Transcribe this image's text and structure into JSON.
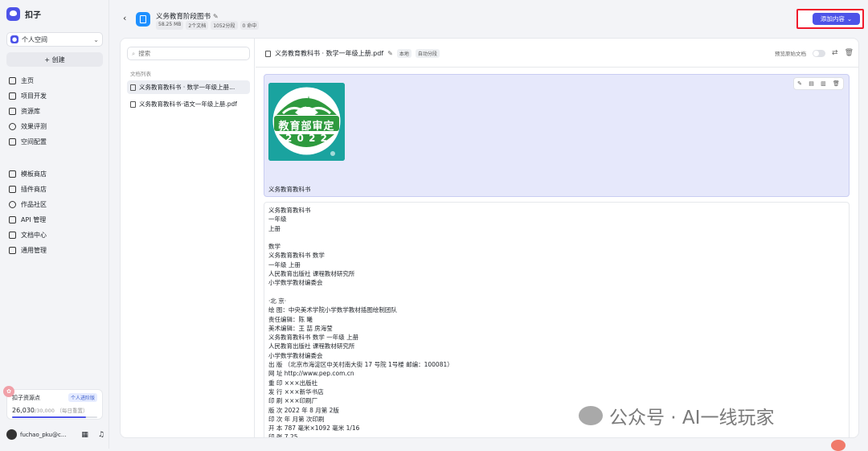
{
  "app": {
    "title": "扣子"
  },
  "sidebar": {
    "space_label": "个人空间",
    "create_label": "+ 创建",
    "nav1": [
      {
        "label": "主页",
        "icon": "home-icon"
      },
      {
        "label": "项目开发",
        "icon": "project-icon"
      },
      {
        "label": "资源库",
        "icon": "library-icon"
      },
      {
        "label": "效果评测",
        "icon": "evaluation-icon"
      },
      {
        "label": "空间配置",
        "icon": "settings-icon"
      }
    ],
    "nav2": [
      {
        "label": "模板商店",
        "icon": "template-icon"
      },
      {
        "label": "插件商店",
        "icon": "plugin-icon"
      },
      {
        "label": "作品社区",
        "icon": "community-icon"
      },
      {
        "label": "API 管理",
        "icon": "api-icon"
      },
      {
        "label": "文档中心",
        "icon": "docs-icon"
      },
      {
        "label": "通用管理",
        "icon": "admin-icon"
      }
    ],
    "resource": {
      "title": "扣子资源点",
      "badge": "个人进阶版",
      "used": "26,030",
      "total": "/30,000",
      "note": "（每日重置）",
      "fill": 0.8677
    },
    "user": {
      "name": "fuchao_pku@c..."
    }
  },
  "header": {
    "kb_title": "义务教育阶段图书",
    "tags": [
      "58.25 MB",
      "2个文档",
      "1052分段",
      "0 命中"
    ],
    "add_button": "添加内容"
  },
  "left_pane": {
    "search_placeholder": "搜索",
    "list_title": "文档列表",
    "docs": [
      "义务教育教科书 · 数学一年级上册...",
      "义务教育教科书·语文一年级上册.pdf"
    ]
  },
  "doc": {
    "title": "义务教育教科书 · 数学一年级上册.pdf",
    "tags": [
      "本地",
      "自动分段"
    ],
    "preview_label": "预览原始文档",
    "image_caption": "义务教育教科书",
    "emblem_top": "教育部审定",
    "emblem_year": "2 0 2 2",
    "text_lines": [
      "义务教育教科书",
      "一年级",
      "上册",
      "",
      "数学",
      "义务教育教科书 数学",
      "一年级 上册",
      "人民教育出版社 课程教材研究所",
      "小学数学教材编委会",
      "",
      "·北 京·",
      "绘 图：中央美术学院小学数学教材插图绘制团队",
      "责任编辑：陈 曦",
      "美术编辑：王 喆 房海莹",
      "义务教育教科书 数学 一年级 上册",
      "人民教育出版社 课程教材研究所",
      "小学数学教材编委会",
      "出 版 （北京市海淀区中关村南大街 17 号院 1号楼 邮编：100081）",
      "网 址 http://www.pep.com.cn",
      "重 印 ×××出版社",
      "发 行 ×××新华书店",
      "印 刷 ×××印刷厂",
      "版 次 2022 年 8 月第 2版",
      "印 次 年 月第 次印刷",
      "开 本 787 毫米×1092 毫米 1/16",
      "印 张 7.25"
    ]
  },
  "watermark": {
    "text": "公众号 · AI一线玩家"
  }
}
